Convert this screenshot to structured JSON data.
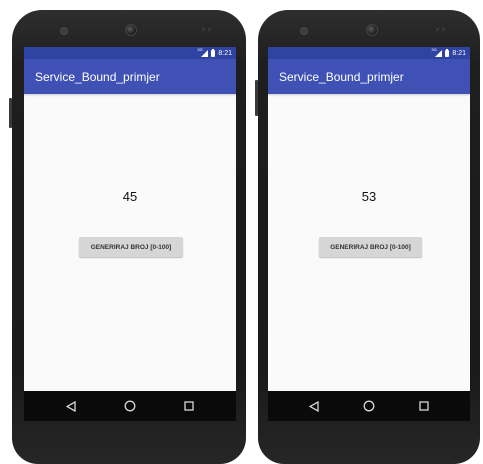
{
  "phones": [
    {
      "status": {
        "time": "8:21",
        "signal_tag": "3G"
      },
      "app_bar": {
        "title": "Service_Bound_primjer"
      },
      "main": {
        "number": "45",
        "button_label": "GENERIRAJ BROJ [0-100]"
      },
      "nav": {
        "back_icon": "back-triangle-icon",
        "home_icon": "home-circle-icon",
        "recents_icon": "recents-square-icon"
      }
    },
    {
      "status": {
        "time": "8:21",
        "signal_tag": "3G"
      },
      "app_bar": {
        "title": "Service_Bound_primjer"
      },
      "main": {
        "number": "53",
        "button_label": "GENERIRAJ BROJ [0-100]"
      },
      "nav": {
        "back_icon": "back-triangle-icon",
        "home_icon": "home-circle-icon",
        "recents_icon": "recents-square-icon"
      }
    }
  ],
  "colors": {
    "status_bar": "#2f43a3",
    "app_bar": "#3f51b5",
    "screen_background": "#fafafa",
    "button_background": "#d6d6d6",
    "phone_body": "#1e1e1e",
    "nav_bar": "#0a0a0a"
  }
}
